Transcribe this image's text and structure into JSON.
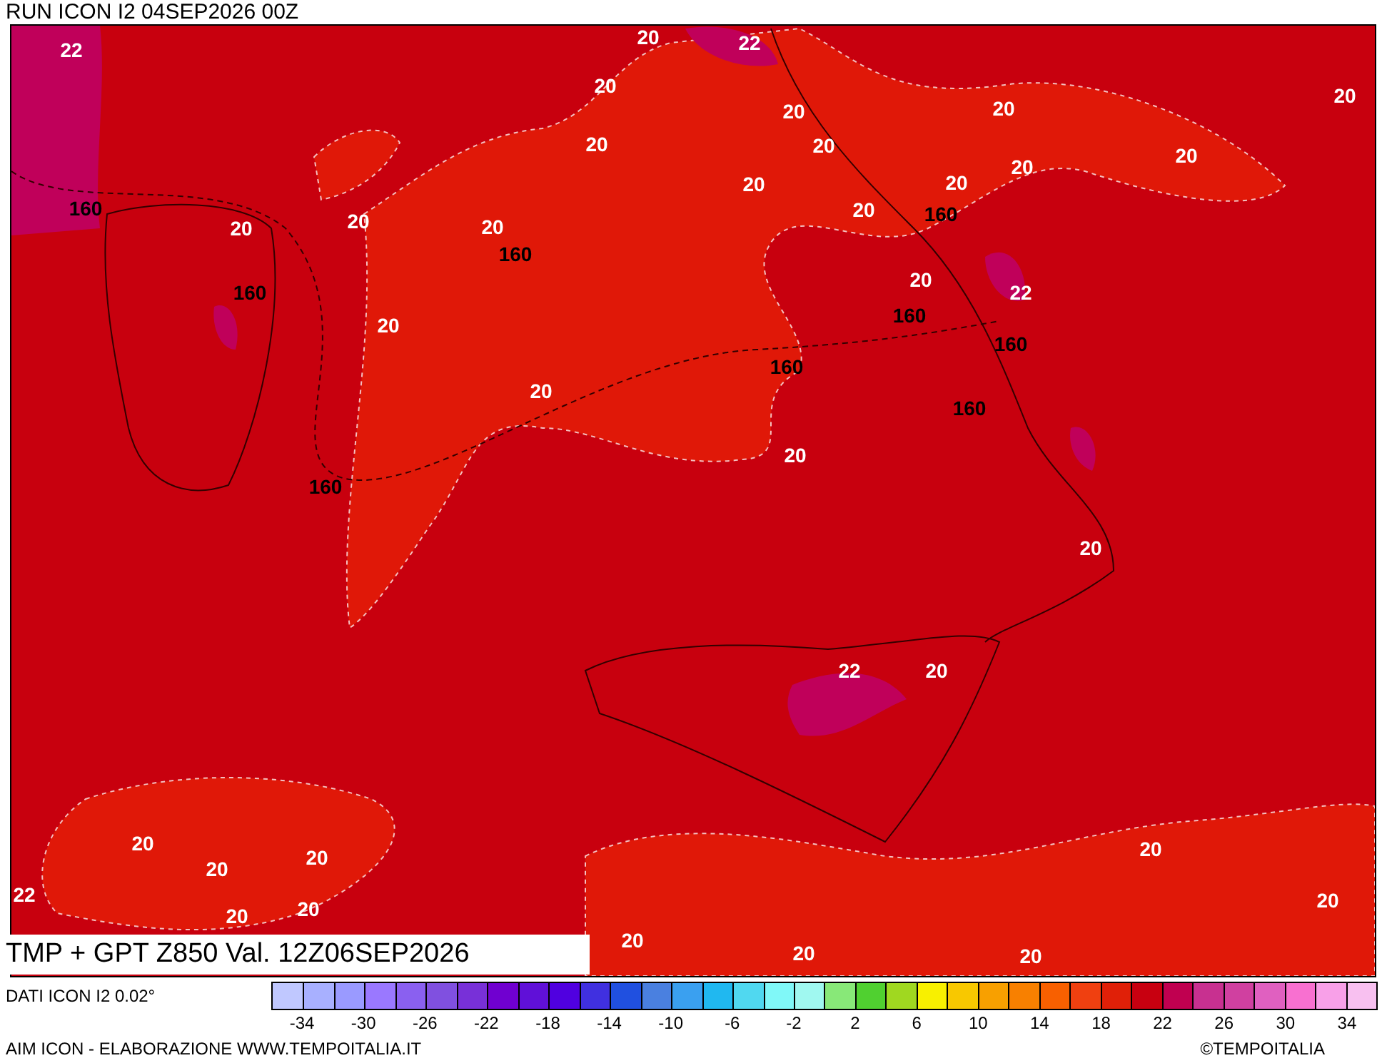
{
  "header": {
    "run_title": "RUN ICON I2 04SEP2026 00Z"
  },
  "map": {
    "title": "TMP + GPT Z850 Val. 12Z06SEP2026",
    "labels": [
      {
        "text": "22",
        "kind": "temp"
      },
      {
        "text": "20",
        "kind": "temp"
      },
      {
        "text": "22",
        "kind": "temp"
      },
      {
        "text": "20",
        "kind": "temp"
      },
      {
        "text": "20",
        "kind": "temp"
      },
      {
        "text": "20",
        "kind": "temp"
      },
      {
        "text": "20",
        "kind": "temp"
      },
      {
        "text": "20",
        "kind": "temp"
      },
      {
        "text": "20",
        "kind": "temp"
      },
      {
        "text": "20",
        "kind": "temp"
      },
      {
        "text": "20",
        "kind": "temp"
      },
      {
        "text": "20",
        "kind": "temp"
      },
      {
        "text": "20",
        "kind": "temp"
      },
      {
        "text": "160",
        "kind": "height"
      },
      {
        "text": "20",
        "kind": "temp"
      },
      {
        "text": "20",
        "kind": "temp"
      },
      {
        "text": "20",
        "kind": "temp"
      },
      {
        "text": "20",
        "kind": "temp"
      },
      {
        "text": "160",
        "kind": "height"
      },
      {
        "text": "160",
        "kind": "height"
      },
      {
        "text": "160",
        "kind": "height"
      },
      {
        "text": "20",
        "kind": "temp"
      },
      {
        "text": "22",
        "kind": "temp"
      },
      {
        "text": "160",
        "kind": "height"
      },
      {
        "text": "20",
        "kind": "temp"
      },
      {
        "text": "160",
        "kind": "height"
      },
      {
        "text": "160",
        "kind": "height"
      },
      {
        "text": "20",
        "kind": "temp"
      },
      {
        "text": "160",
        "kind": "height"
      },
      {
        "text": "20",
        "kind": "temp"
      },
      {
        "text": "160",
        "kind": "height"
      },
      {
        "text": "20",
        "kind": "temp"
      },
      {
        "text": "22",
        "kind": "temp"
      },
      {
        "text": "20",
        "kind": "temp"
      },
      {
        "text": "20",
        "kind": "temp"
      },
      {
        "text": "20",
        "kind": "temp"
      },
      {
        "text": "20",
        "kind": "temp"
      },
      {
        "text": "20",
        "kind": "temp"
      },
      {
        "text": "22",
        "kind": "temp"
      },
      {
        "text": "20",
        "kind": "temp"
      },
      {
        "text": "20",
        "kind": "temp"
      },
      {
        "text": "20",
        "kind": "temp"
      },
      {
        "text": "20",
        "kind": "temp"
      },
      {
        "text": "20",
        "kind": "temp"
      },
      {
        "text": "20",
        "kind": "temp"
      }
    ]
  },
  "legend": {
    "source": "DATI ICON I2 0.02°",
    "swatches": [
      {
        "color": "#c0c8ff"
      },
      {
        "color": "#a8b0ff"
      },
      {
        "color": "#9a9aff"
      },
      {
        "color": "#9a78ff"
      },
      {
        "color": "#8a60f0"
      },
      {
        "color": "#8050e0"
      },
      {
        "color": "#7830d8"
      },
      {
        "color": "#7000d0"
      },
      {
        "color": "#6010d8"
      },
      {
        "color": "#5000e0"
      },
      {
        "color": "#4030e0"
      },
      {
        "color": "#2050e0"
      },
      {
        "color": "#4a80e0"
      },
      {
        "color": "#3aa0f0"
      },
      {
        "color": "#20b8f0"
      },
      {
        "color": "#50d8f0"
      },
      {
        "color": "#80f8f8"
      },
      {
        "color": "#a0f8f0"
      },
      {
        "color": "#88e878"
      },
      {
        "color": "#50d030"
      },
      {
        "color": "#a0d820"
      },
      {
        "color": "#f8f000"
      },
      {
        "color": "#f8c800"
      },
      {
        "color": "#f8a000"
      },
      {
        "color": "#f88000"
      },
      {
        "color": "#f86000"
      },
      {
        "color": "#f04010"
      },
      {
        "color": "#e02008"
      },
      {
        "color": "#c80010"
      },
      {
        "color": "#c00050"
      },
      {
        "color": "#c83090"
      },
      {
        "color": "#d040a0"
      },
      {
        "color": "#e060c0"
      },
      {
        "color": "#f870d0"
      },
      {
        "color": "#f8a0e8"
      },
      {
        "color": "#f8c0f0"
      }
    ],
    "ticks": [
      "-34",
      "-30",
      "-26",
      "-22",
      "-18",
      "-14",
      "-10",
      "-6",
      "-2",
      "2",
      "6",
      "10",
      "14",
      "18",
      "22",
      "26",
      "30",
      "34"
    ]
  },
  "footer": {
    "credit": "AIM ICON - ELABORAZIONE WWW.TEMPOITALIA.IT",
    "copyright": "©TEMPOITALIA"
  }
}
